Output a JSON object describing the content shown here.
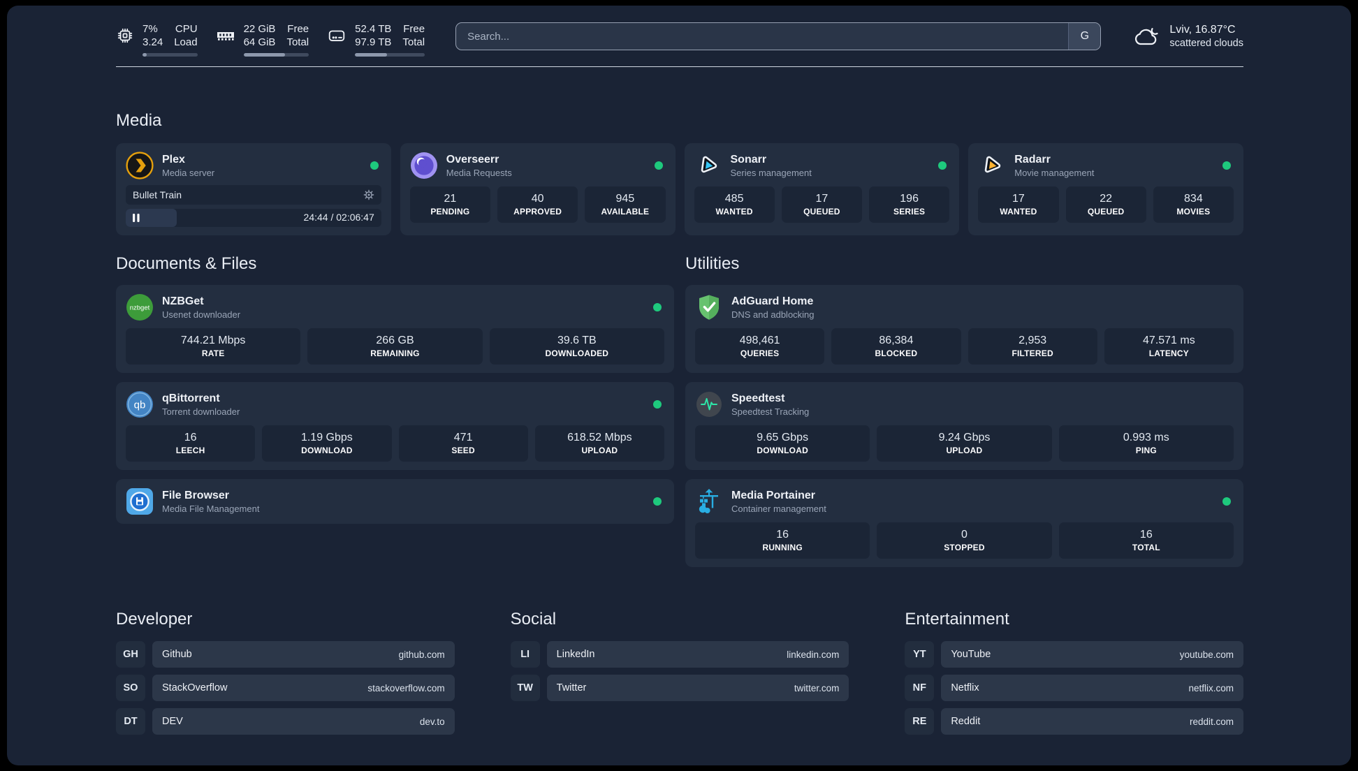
{
  "header": {
    "stats": [
      {
        "icon": "cpu-icon",
        "values": [
          "7%",
          "3.24"
        ],
        "labels": [
          "CPU",
          "Load"
        ],
        "progress_pct": 7
      },
      {
        "icon": "ram-icon",
        "values": [
          "22 GiB",
          "64 GiB"
        ],
        "labels": [
          "Free",
          "Total"
        ],
        "progress_pct": 64
      },
      {
        "icon": "disk-icon",
        "values": [
          "52.4 TB",
          "97.9 TB"
        ],
        "labels": [
          "Free",
          "Total"
        ],
        "progress_pct": 46
      }
    ],
    "search": {
      "placeholder": "Search...",
      "engine_button": "G"
    },
    "weather": {
      "icon": "cloud-icon",
      "location_temperature": "Lviv, 16.87°C",
      "condition": "scattered clouds"
    }
  },
  "colors": {
    "status_online": "#1ec97d",
    "background": "#1a2335",
    "card": "#232e40"
  },
  "sections": {
    "media": {
      "title": "Media",
      "plex": {
        "icon": "plex-icon",
        "name": "Plex",
        "description": "Media server",
        "status": "online",
        "now_playing": {
          "title": "Bullet Train",
          "time": "24:44 / 02:06:47",
          "progress_pct": 20
        }
      },
      "overseerr": {
        "icon": "overseerr-icon",
        "name": "Overseerr",
        "description": "Media Requests",
        "status": "online",
        "stats": [
          {
            "value": "21",
            "label": "PENDING"
          },
          {
            "value": "40",
            "label": "APPROVED"
          },
          {
            "value": "945",
            "label": "AVAILABLE"
          }
        ]
      },
      "sonarr": {
        "icon": "sonarr-icon",
        "name": "Sonarr",
        "description": "Series management",
        "status": "online",
        "stats": [
          {
            "value": "485",
            "label": "WANTED"
          },
          {
            "value": "17",
            "label": "QUEUED"
          },
          {
            "value": "196",
            "label": "SERIES"
          }
        ]
      },
      "radarr": {
        "icon": "radarr-icon",
        "name": "Radarr",
        "description": "Movie management",
        "status": "online",
        "stats": [
          {
            "value": "17",
            "label": "WANTED"
          },
          {
            "value": "22",
            "label": "QUEUED"
          },
          {
            "value": "834",
            "label": "MOVIES"
          }
        ]
      }
    },
    "documents": {
      "title": "Documents & Files",
      "nzbget": {
        "icon": "nzbget-icon",
        "name": "NZBGet",
        "description": "Usenet downloader",
        "status": "online",
        "stats": [
          {
            "value": "744.21 Mbps",
            "label": "RATE"
          },
          {
            "value": "266 GB",
            "label": "REMAINING"
          },
          {
            "value": "39.6 TB",
            "label": "DOWNLOADED"
          }
        ]
      },
      "qbittorrent": {
        "icon": "qbittorrent-icon",
        "name": "qBittorrent",
        "description": "Torrent downloader",
        "status": "online",
        "stats": [
          {
            "value": "16",
            "label": "LEECH"
          },
          {
            "value": "1.19 Gbps",
            "label": "DOWNLOAD"
          },
          {
            "value": "471",
            "label": "SEED"
          },
          {
            "value": "618.52 Mbps",
            "label": "UPLOAD"
          }
        ]
      },
      "filebrowser": {
        "icon": "filebrowser-icon",
        "name": "File Browser",
        "description": "Media File Management",
        "status": "online"
      }
    },
    "utilities": {
      "title": "Utilities",
      "adguard": {
        "icon": "adguard-icon",
        "name": "AdGuard Home",
        "description": "DNS and adblocking",
        "stats": [
          {
            "value": "498,461",
            "label": "QUERIES"
          },
          {
            "value": "86,384",
            "label": "BLOCKED"
          },
          {
            "value": "2,953",
            "label": "FILTERED"
          },
          {
            "value": "47.571 ms",
            "label": "LATENCY"
          }
        ]
      },
      "speedtest": {
        "icon": "speedtest-icon",
        "name": "Speedtest",
        "description": "Speedtest Tracking",
        "stats": [
          {
            "value": "9.65 Gbps",
            "label": "DOWNLOAD"
          },
          {
            "value": "9.24 Gbps",
            "label": "UPLOAD"
          },
          {
            "value": "0.993 ms",
            "label": "PING"
          }
        ]
      },
      "portainer": {
        "icon": "portainer-icon",
        "name": "Media Portainer",
        "description": "Container management",
        "status": "online",
        "stats": [
          {
            "value": "16",
            "label": "RUNNING"
          },
          {
            "value": "0",
            "label": "STOPPED"
          },
          {
            "value": "16",
            "label": "TOTAL"
          }
        ]
      }
    },
    "developer": {
      "title": "Developer",
      "links": [
        {
          "abbr": "GH",
          "name": "Github",
          "url": "github.com"
        },
        {
          "abbr": "SO",
          "name": "StackOverflow",
          "url": "stackoverflow.com"
        },
        {
          "abbr": "DT",
          "name": "DEV",
          "url": "dev.to"
        }
      ]
    },
    "social": {
      "title": "Social",
      "links": [
        {
          "abbr": "LI",
          "name": "LinkedIn",
          "url": "linkedin.com"
        },
        {
          "abbr": "TW",
          "name": "Twitter",
          "url": "twitter.com"
        }
      ]
    },
    "entertainment": {
      "title": "Entertainment",
      "links": [
        {
          "abbr": "YT",
          "name": "YouTube",
          "url": "youtube.com"
        },
        {
          "abbr": "NF",
          "name": "Netflix",
          "url": "netflix.com"
        },
        {
          "abbr": "RE",
          "name": "Reddit",
          "url": "reddit.com"
        }
      ]
    }
  }
}
